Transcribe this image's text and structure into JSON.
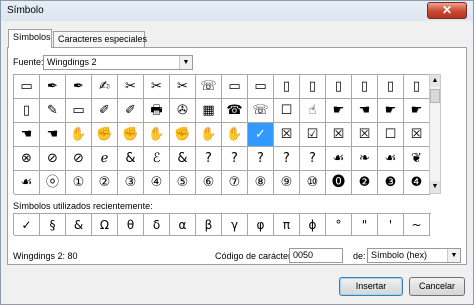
{
  "window": {
    "title": "Símbolo",
    "close_glyph": "✕"
  },
  "tabs": [
    {
      "label": "Símbolos",
      "active": true
    },
    {
      "label": "Caracteres especiales",
      "active": false
    }
  ],
  "font": {
    "label": "Fuente:",
    "value": "Wingdings 2"
  },
  "symbols": [
    "▭",
    "✒",
    "✒",
    "✍",
    "✂",
    "✂",
    "✂",
    "☏",
    "▭",
    "▭",
    "▯",
    "▯",
    "▯",
    "▯",
    "▯",
    "▯",
    "▯",
    "✎",
    "▭",
    "✐",
    "✐",
    "🖶",
    "✇",
    "▦",
    "☎",
    "☏",
    "☐",
    "☝",
    "☛",
    "☚",
    "☛",
    "☛",
    "☚",
    "☚",
    "✋",
    "✊",
    "✊",
    "✋",
    "✊",
    "✋",
    "✋",
    "✓",
    "☒",
    "☑",
    "☒",
    "☒",
    "☐",
    "☒",
    "⊗",
    "⊘",
    "⊘",
    "ℯ",
    "&",
    "ℰ",
    "&",
    "?",
    "?",
    "?",
    "?",
    "?",
    "☙",
    "❧",
    "☙",
    "❦",
    "☙",
    "ⓞ",
    "①",
    "②",
    "③",
    "④",
    "⑤",
    "⑥",
    "⑦",
    "⑧",
    "⑨",
    "⑩",
    "⓿",
    "❷",
    "❸",
    "❹"
  ],
  "selected_index": 41,
  "recent": {
    "label": "Símbolos utilizados recientemente:",
    "symbols": [
      "✓",
      "§",
      "&",
      "Ω",
      "θ",
      "δ",
      "α",
      "β",
      "γ",
      "φ",
      "π",
      "ϕ",
      "°",
      "\"",
      "'",
      "~"
    ]
  },
  "status": {
    "text": "Wingdings 2: 80"
  },
  "char_code": {
    "label": "Código de carácter:",
    "value": "0050"
  },
  "from": {
    "label": "de:",
    "value": "Símbolo (hex)"
  },
  "buttons": {
    "insert": "Insertar",
    "cancel": "Cancelar"
  },
  "scroll": {
    "up": "▲",
    "down": "▼"
  }
}
